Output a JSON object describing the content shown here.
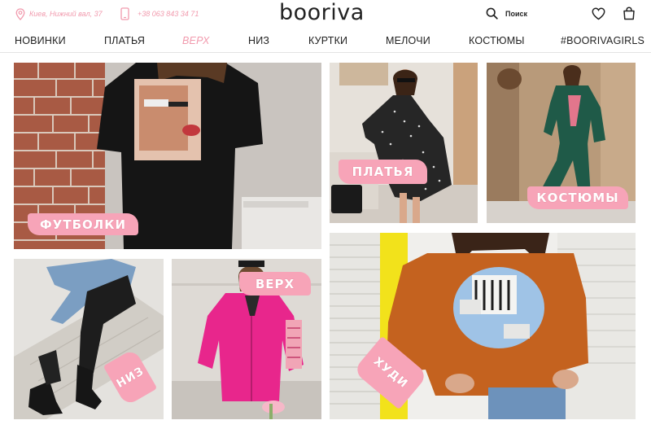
{
  "header": {
    "address": "Киев, Нижний вал, 37",
    "phone": "+38 063 843 34 71",
    "logo": "booriva",
    "search_label": "Поиск",
    "icons": [
      "location-pin-icon",
      "phone-icon",
      "search-icon",
      "heart-icon",
      "shopping-bag-icon"
    ]
  },
  "nav": {
    "items": [
      {
        "label": "НОВИНКИ"
      },
      {
        "label": "ПЛАТЬЯ"
      },
      {
        "label": "ВЕРХ",
        "active": true
      },
      {
        "label": "НИЗ"
      },
      {
        "label": "КУРТКИ"
      },
      {
        "label": "МЕЛОЧИ"
      },
      {
        "label": "КОСТЮМЫ"
      },
      {
        "label": "#BOORIVAGIRLS"
      }
    ]
  },
  "categories": {
    "tshirts": "ФУТБОЛКИ",
    "dresses": "ПЛАТЬЯ",
    "suits": "КОСТЮМЫ",
    "bottoms": "НИЗ",
    "tops": "ВЕРХ",
    "hoodies": "ХУДИ"
  },
  "colors": {
    "accent": "#f7a4b8",
    "accent_text": "#f19aad",
    "text": "#222222"
  }
}
